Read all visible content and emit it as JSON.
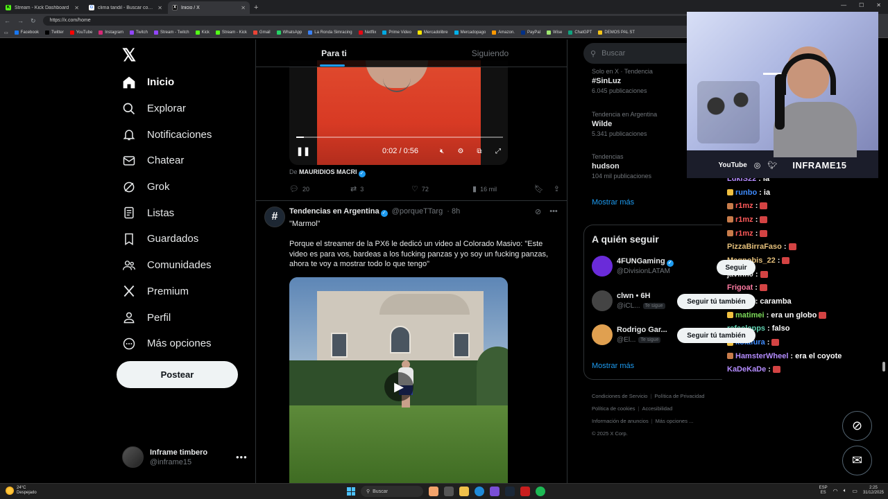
{
  "browser": {
    "tabs": [
      {
        "label": "Stream - Kick Dashboard",
        "icon": "kick-favicon",
        "color": "#53fc18"
      },
      {
        "label": "clima tandil - Buscar con Google",
        "icon": "google-favicon",
        "color": "#ffffff"
      },
      {
        "label": "Inicio / X",
        "icon": "x-favicon",
        "color": "#000000"
      }
    ],
    "url": "https://x.com/home",
    "bookmarks": [
      {
        "label": "Facebook",
        "color": "#1877f2"
      },
      {
        "label": "Twitter",
        "color": "#000000"
      },
      {
        "label": "YouTube",
        "color": "#ff0000"
      },
      {
        "label": "Instagram",
        "color": "#d62976"
      },
      {
        "label": "Twitch",
        "color": "#9146ff"
      },
      {
        "label": "Stream - Twitch",
        "color": "#9146ff"
      },
      {
        "label": "Kick",
        "color": "#53fc18"
      },
      {
        "label": "Stream - Kick",
        "color": "#53fc18"
      },
      {
        "label": "Gmail",
        "color": "#ea4335"
      },
      {
        "label": "WhatsApp",
        "color": "#25d366"
      },
      {
        "label": "La Ronda Simracing",
        "color": "#3b82f6"
      },
      {
        "label": "Netflix",
        "color": "#e50914"
      },
      {
        "label": "Prime Video",
        "color": "#00a8e1"
      },
      {
        "label": "Mercadolibre",
        "color": "#ffe600"
      },
      {
        "label": "Mercadopago",
        "color": "#00b1ea"
      },
      {
        "label": "Amazon.",
        "color": "#ff9900"
      },
      {
        "label": "PayPal",
        "color": "#003087"
      },
      {
        "label": "Wise",
        "color": "#9fe870"
      },
      {
        "label": "ChatGPT",
        "color": "#10a37f"
      },
      {
        "label": "DEMOS PAL ST",
        "color": "#f5c518"
      }
    ]
  },
  "nav": {
    "items": [
      {
        "label": "Inicio",
        "icon": "home-icon"
      },
      {
        "label": "Explorar",
        "icon": "search-icon"
      },
      {
        "label": "Notificaciones",
        "icon": "bell-icon"
      },
      {
        "label": "Chatear",
        "icon": "mail-icon"
      },
      {
        "label": "Grok",
        "icon": "grok-icon"
      },
      {
        "label": "Listas",
        "icon": "list-icon"
      },
      {
        "label": "Guardados",
        "icon": "bookmark-icon"
      },
      {
        "label": "Comunidades",
        "icon": "people-icon"
      },
      {
        "label": "Premium",
        "icon": "x-icon"
      },
      {
        "label": "Perfil",
        "icon": "person-icon"
      },
      {
        "label": "Más opciones",
        "icon": "more-circle-icon"
      }
    ],
    "post_button": "Postear",
    "account": {
      "name": "Inframe timbero",
      "handle": "@inframe15"
    }
  },
  "feed": {
    "tabs": [
      "Para ti",
      "Siguiendo"
    ],
    "video1": {
      "time": "0:02 / 0:56",
      "progress": 0.036
    },
    "source_prefix": "De",
    "source_name": "MAURIDIOS MACRI",
    "stats": {
      "replies": "20",
      "reposts": "3",
      "likes": "72",
      "views": "16 mil"
    },
    "post2": {
      "author": "Tendencias en Argentina",
      "handle": "@porqueTTarg",
      "time": "· 8h",
      "quote": "\"Marmol\"",
      "text": "Porque el streamer de la PX6 le dedicó un video al Colorado Masivo: \"Este video es para vos, bardeas a los fucking panzas y yo soy un fucking panzas, ahora te voy a mostrar todo lo que tengo\""
    }
  },
  "sidebar": {
    "search_placeholder": "Buscar",
    "trends": [
      {
        "meta": "Solo en X · Tendencia",
        "name": "#SinLuz",
        "count": "6.045 publicaciones"
      },
      {
        "meta": "Tendencia en Argentina",
        "name": "Wilde",
        "count": "5.341 publicaciones"
      },
      {
        "meta": "Tendencias",
        "name": "hudson",
        "count": "104 mil publicaciones"
      }
    ],
    "show_more": "Mostrar más",
    "follow_title": "A quién seguir",
    "follow": [
      {
        "name": "4FUNGaming",
        "handle": "@DivisionLATAM",
        "badge": "",
        "button": "Seguir",
        "color": "#6a2bd9"
      },
      {
        "name": "clwn • 6H",
        "handle": "@iCL...",
        "badge": "Te sigue",
        "button": "Seguir tú también",
        "color": "#444444"
      },
      {
        "name": "Rodrigo Gar...",
        "handle": "@El...",
        "badge": "Te sigue",
        "button": "Seguir tú también",
        "color": "#e0a050"
      }
    ],
    "show_more_2": "Mostrar más",
    "footer": {
      "line1": [
        "Condiciones de Servicio",
        "Política de Privacidad"
      ],
      "line2": [
        "Política de cookies",
        "Accesibilidad"
      ],
      "line3": [
        "Información de anuncios",
        "Más opciones ..."
      ],
      "copyright": "© 2025 X Corp."
    }
  },
  "stream": {
    "bar": {
      "youtube": "YouTube",
      "brand": "INFRAME15"
    },
    "chat": [
      {
        "user": "LukiS22",
        "msg": ": ia",
        "color": "#b48cff",
        "badge": "",
        "emote": false
      },
      {
        "user": "runbo",
        "msg": ": ia",
        "color": "#3f8cff",
        "badge": "#f0c040",
        "emote": false
      },
      {
        "user": "r1mz",
        "msg": ":",
        "color": "#ff5a5a",
        "badge": "#c77b4a",
        "emote": true
      },
      {
        "user": "r1mz",
        "msg": ":",
        "color": "#ff5a5a",
        "badge": "#c77b4a",
        "emote": true
      },
      {
        "user": "r1mz",
        "msg": ":",
        "color": "#ff5a5a",
        "badge": "#c77b4a",
        "emote": true
      },
      {
        "user": "PizzaBirraFaso",
        "msg": ":",
        "color": "#e5c07b",
        "badge": "",
        "emote": true
      },
      {
        "user": "Magnobis_22",
        "msg": ":",
        "color": "#e5c07b",
        "badge": "",
        "emote": true
      },
      {
        "user": "javinh0",
        "msg": ":",
        "color": "#dddddd",
        "badge": "",
        "emote": true
      },
      {
        "user": "Frigoat",
        "msg": ":",
        "color": "#ff7aa2",
        "badge": "",
        "emote": true
      },
      {
        "user": "r1mz",
        "msg": ": caramba",
        "color": "#ff5a5a",
        "badge": "#c77b4a",
        "emote": false
      },
      {
        "user": "matimei",
        "msg": ": era un globo",
        "color": "#7ddc5a",
        "badge": "#f0c040",
        "emote": true
      },
      {
        "user": "rafaelapps",
        "msg": ": falso",
        "color": "#5fd1b0",
        "badge": "",
        "emote": false
      },
      {
        "user": "kolafura",
        "msg": ":",
        "color": "#3f8cff",
        "badge": "#f0c040",
        "emote": true
      },
      {
        "user": "HamsterWheel",
        "msg": ": era el coyote",
        "color": "#b48cff",
        "badge": "#c77b4a",
        "emote": false
      },
      {
        "user": "KaDeKaDe",
        "msg": ":",
        "color": "#b48cff",
        "badge": "",
        "emote": true
      }
    ]
  },
  "taskbar": {
    "weather_temp": "24°C",
    "weather_desc": "Despejado",
    "search": "Buscar",
    "lang1": "ESP",
    "lang2": "ES",
    "time": "2:25",
    "date": "31/12/2025"
  }
}
